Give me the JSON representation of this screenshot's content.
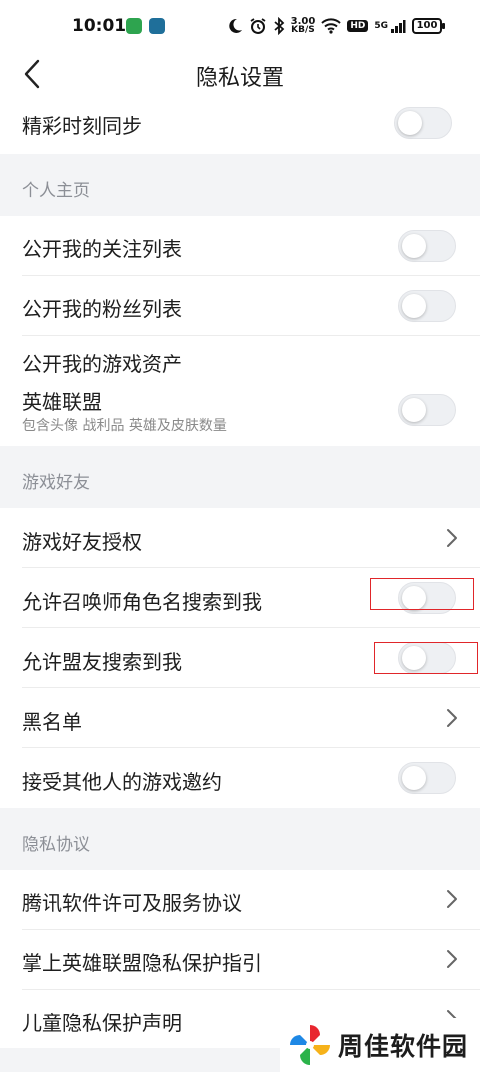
{
  "status_bar": {
    "time": "10:01",
    "net_speed_value": "3.00",
    "net_speed_unit": "KB/S",
    "hd": "HD",
    "network": "5G",
    "battery": "100",
    "app_icon_colors": [
      "#2ea44f",
      "#1f6f9a"
    ]
  },
  "nav": {
    "title": "隐私设置",
    "back_icon": "chevron-left-icon"
  },
  "rows": {
    "highlights_sync": "精彩时刻同步",
    "follow_list": "公开我的关注列表",
    "fans_list": "公开我的粉丝列表",
    "game_assets": "公开我的游戏资产",
    "lol_title": "英雄联盟",
    "lol_subtitle": "包含头像 战利品 英雄及皮肤数量",
    "friend_auth": "游戏好友授权",
    "summoner_search": "允许召唤师角色名搜索到我",
    "ally_search": "允许盟友搜索到我",
    "blacklist": "黑名单",
    "accept_invite": "接受其他人的游戏邀约",
    "tencent_license": "腾讯软件许可及服务协议",
    "privacy_guide": "掌上英雄联盟隐私保护指引",
    "child_privacy": "儿童隐私保护声明"
  },
  "sections": {
    "profile": "个人主页",
    "game_friends": "游戏好友",
    "privacy_agreement": "隐私协议"
  },
  "toggles": {
    "highlights_sync": false,
    "follow_list": false,
    "fans_list": false,
    "lol_assets": false,
    "summoner_search": false,
    "ally_search": false,
    "accept_invite": false
  },
  "watermark": {
    "text": "周佳软件园",
    "colors": [
      "#e8262e",
      "#f6b21a",
      "#2bb34a",
      "#1e88e5"
    ]
  },
  "colors": {
    "section_bg": "#f3f4f6",
    "highlight_border": "#e0262a",
    "toggle_off": "#eef0f3"
  }
}
